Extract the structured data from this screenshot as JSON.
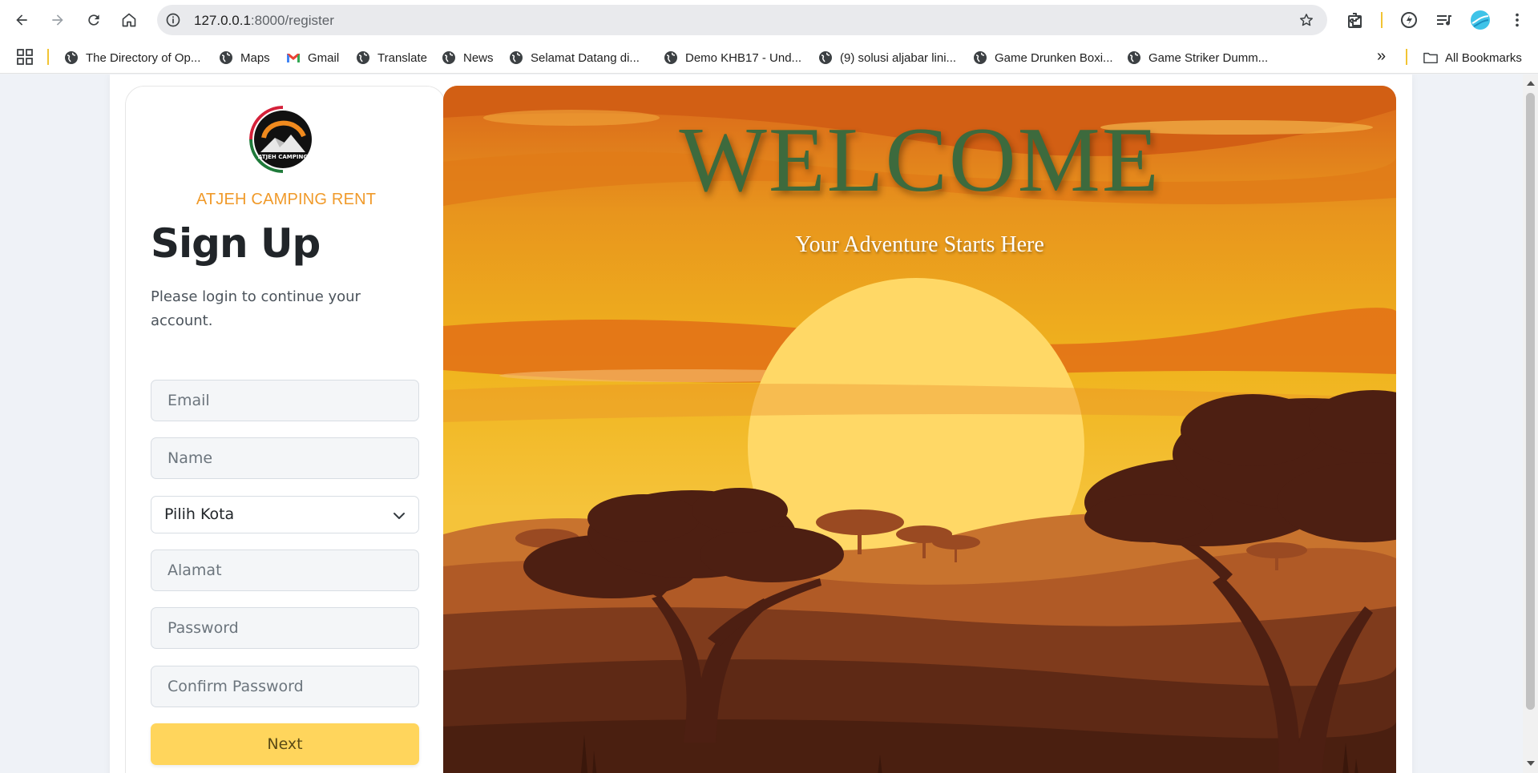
{
  "browser": {
    "url_host": "127.0.0.1",
    "url_path": ":8000/register",
    "bookmarks": [
      {
        "label": "The Directory of Op..."
      },
      {
        "label": "Maps"
      },
      {
        "label": "Gmail"
      },
      {
        "label": "Translate"
      },
      {
        "label": "News"
      },
      {
        "label": "Selamat Datang di..."
      },
      {
        "label": "Demo KHB17 - Und..."
      },
      {
        "label": "(9) solusi aljabar lini..."
      },
      {
        "label": "Game Drunken Boxi..."
      },
      {
        "label": "Game Striker Dumm..."
      }
    ],
    "overflow_label": "»",
    "all_bookmarks_label": "All Bookmarks"
  },
  "form": {
    "brand": "ATJEH CAMPING RENT",
    "logo_text": "ATJEH CAMPING",
    "title": "Sign Up",
    "subtitle": "Please login to continue your account.",
    "email_placeholder": "Email",
    "name_placeholder": "Name",
    "city_selected": "Pilih Kota",
    "address_placeholder": "Alamat",
    "password_placeholder": "Password",
    "confirm_placeholder": "Confirm Password",
    "next_label": "Next"
  },
  "hero": {
    "heading": "WELCOME",
    "tagline": "Your Adventure Starts Here"
  },
  "colors": {
    "brand_orange": "#f09a2a",
    "button_yellow": "#ffd55c",
    "welcome_green": "#3d6a3d",
    "sky_orange": "#e0741a",
    "sun_yellow": "#ffd866"
  }
}
